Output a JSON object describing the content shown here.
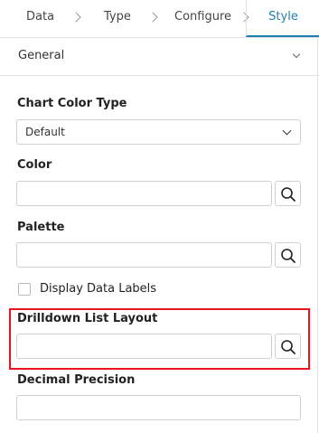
{
  "tabs": {
    "data": "Data",
    "type": "Type",
    "configure": "Configure",
    "style": "Style"
  },
  "section": {
    "title": "General"
  },
  "fields": {
    "chart_color_type": {
      "label": "Chart Color Type",
      "value": "Default"
    },
    "color": {
      "label": "Color",
      "value": ""
    },
    "palette": {
      "label": "Palette",
      "value": ""
    },
    "display_data_labels": {
      "label": "Display Data Labels",
      "checked": false
    },
    "drilldown_list_layout": {
      "label": "Drilldown List Layout",
      "value": ""
    },
    "decimal_precision": {
      "label": "Decimal Precision",
      "value": ""
    }
  },
  "colors": {
    "accent": "#1d7fb0",
    "highlight": "#e8141c",
    "border": "#cfcfcf"
  },
  "icons": {
    "lookup": "search-icon",
    "tab_separator": "chevron-right-icon",
    "section_toggle": "chevron-down-icon"
  }
}
